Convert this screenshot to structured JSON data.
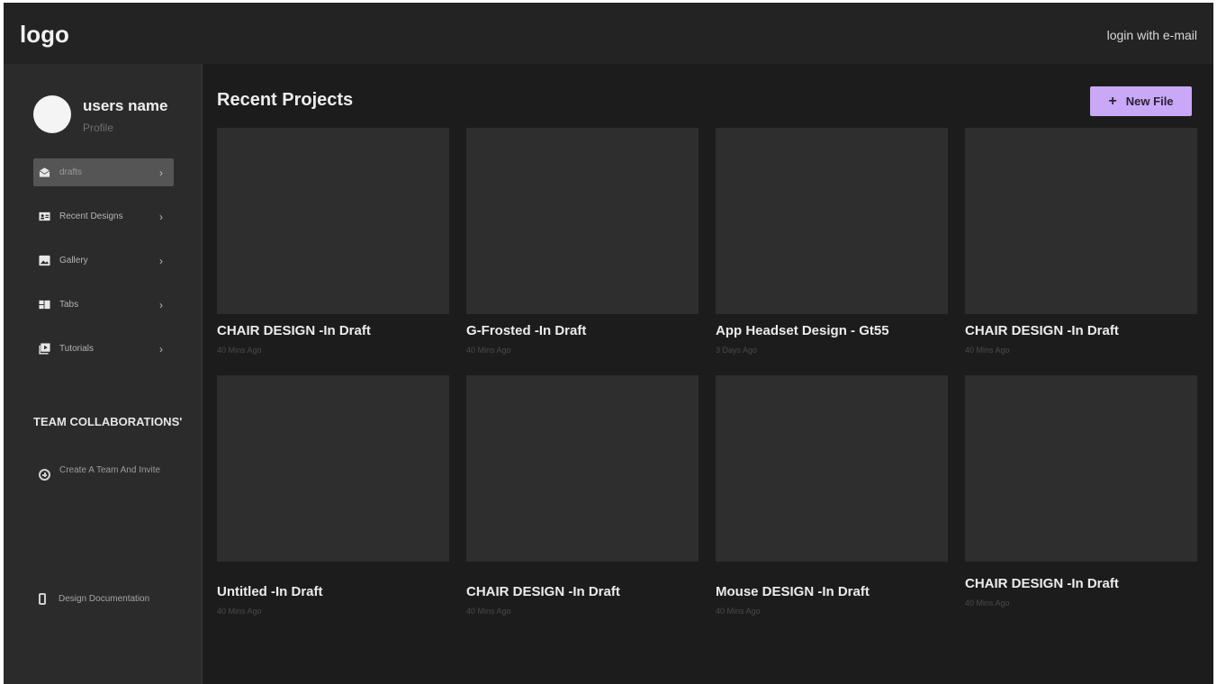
{
  "header": {
    "logo": "logo",
    "login_label": "login with e-mail"
  },
  "user": {
    "name": "users name",
    "profile_label": "Profile"
  },
  "sidebar": {
    "items": [
      {
        "label": "drafts",
        "icon": "mail-icon",
        "active": true
      },
      {
        "label": "Recent Designs",
        "icon": "contact-card-icon",
        "active": false
      },
      {
        "label": "Gallery",
        "icon": "image-icon",
        "active": false
      },
      {
        "label": "Tabs",
        "icon": "tabs-icon",
        "active": false
      },
      {
        "label": "Tutorials",
        "icon": "video-icon",
        "active": false
      }
    ],
    "team_heading": "TEAM COLLABORATIONS'",
    "team_action": "Create A Team And Invite",
    "documentation": "Design Documentation"
  },
  "main": {
    "title": "Recent Projects",
    "new_file_label": "New File",
    "projects": [
      {
        "title": "CHAIR DESIGN -In Draft",
        "meta": "40 Mins Ago"
      },
      {
        "title": "G-Frosted -In Draft",
        "meta": "40 Mins Ago"
      },
      {
        "title": "App Headset Design - Gt55",
        "meta": "3 Days Ago"
      },
      {
        "title": "CHAIR DESIGN -In Draft",
        "meta": "40 Mins Ago"
      },
      {
        "title": "Untitled -In Draft",
        "meta": "40 Mins Ago"
      },
      {
        "title": "CHAIR DESIGN -In Draft",
        "meta": "40 Mins Ago"
      },
      {
        "title": "Mouse DESIGN -In Draft",
        "meta": "40 Mins Ago"
      },
      {
        "title": "CHAIR DESIGN -In Draft",
        "meta": "40 Mins Ago"
      }
    ]
  },
  "colors": {
    "accent": "#c9a8f7",
    "background": "#1c1c1c",
    "sidebar": "#2b2b2b",
    "card": "#2e2e2f"
  }
}
